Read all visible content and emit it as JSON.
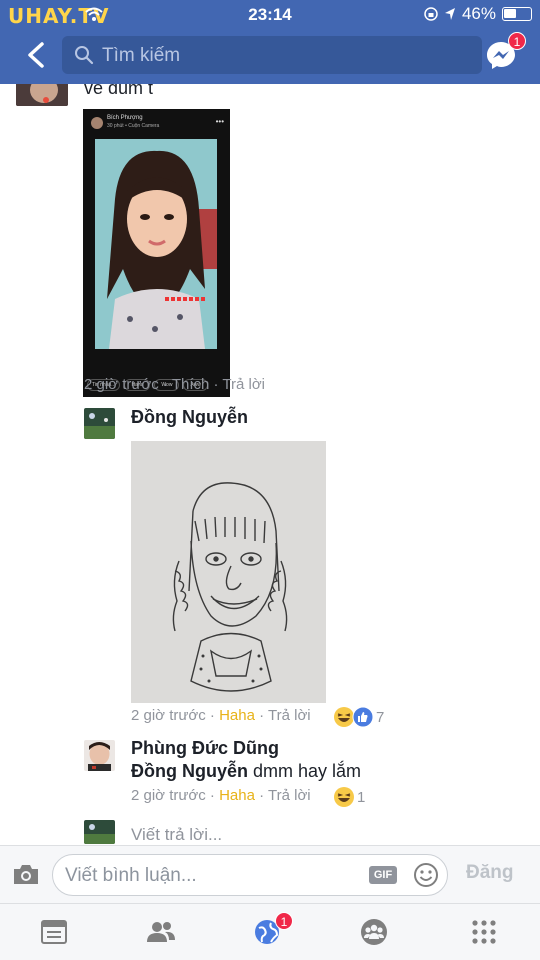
{
  "status_bar": {
    "carrier": "UHAY.TV",
    "time": "23:14",
    "battery": "46%",
    "battery_level": 0.46
  },
  "nav": {
    "search_placeholder": "Tìm kiếm",
    "messenger_badge": "1"
  },
  "comments": [
    {
      "text": "vẽ dùm t",
      "screenshot": {
        "poster": "Bích Phượng",
        "sub": "30 phút • Cuộn Camera",
        "buttons": [
          "Tin nhắn...",
          "Haha",
          "Wow",
          "Aww"
        ]
      },
      "time": "2 giờ trước",
      "like": "Thích",
      "reply": "Trả lời"
    },
    {
      "name": "Đồng Nguyễn",
      "time": "2 giờ trước",
      "reaction": "Haha",
      "reply": "Trả lời",
      "reaction_count": "7"
    },
    {
      "name": "Phùng Đức Dũng",
      "mention": "Đồng Nguyễn",
      "text": "dmm hay lắm",
      "time": "2 giờ trước",
      "reaction": "Haha",
      "reply": "Trả lời",
      "reaction_count": "1"
    }
  ],
  "reply_prompt": "Viết trả lời...",
  "composer": {
    "placeholder": "Viết bình luận...",
    "gif": "GIF",
    "post": "Đăng"
  },
  "tabs": {
    "notifications_badge": "1"
  },
  "icons": [
    "back-icon",
    "search-icon",
    "messenger-icon",
    "camera-icon",
    "smiley-icon",
    "news-feed-icon",
    "friends-icon",
    "globe-notifications-icon",
    "groups-icon",
    "menu-grid-icon"
  ],
  "colors": {
    "brand": "#4267b2",
    "haha": "#e8b31a",
    "badge": "#f02849",
    "meta": "#90949c"
  }
}
